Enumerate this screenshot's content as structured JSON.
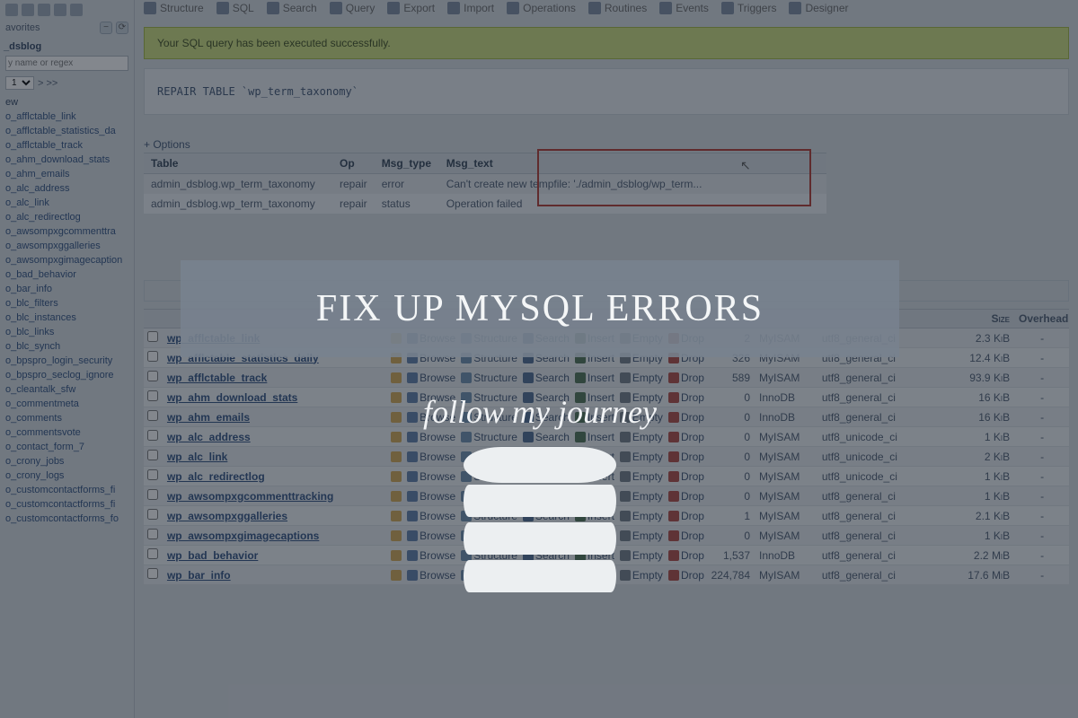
{
  "top_tabs": [
    "Structure",
    "SQL",
    "Search",
    "Query",
    "Export",
    "Import",
    "Operations",
    "Routines",
    "Events",
    "Triggers",
    "Designer"
  ],
  "sidebar": {
    "favorites_label": "avorites",
    "db_label": "_dsblog",
    "filter_placeholder": "y name or regex",
    "pager_value": "1",
    "pager_nav": "> >>",
    "new_label": "ew",
    "tables": [
      "o_afflctable_link",
      "o_afflctable_statistics_da",
      "o_afflctable_track",
      "o_ahm_download_stats",
      "o_ahm_emails",
      "o_alc_address",
      "o_alc_link",
      "o_alc_redirectlog",
      "o_awsompxgcommenttra",
      "o_awsompxggalleries",
      "o_awsompxgimagecaption",
      "o_bad_behavior",
      "o_bar_info",
      "o_blc_filters",
      "o_blc_instances",
      "o_blc_links",
      "o_blc_synch",
      "o_bpspro_login_security",
      "o_bpspro_seclog_ignore",
      "o_cleantalk_sfw",
      "o_commentmeta",
      "o_comments",
      "o_commentsvote",
      "o_contact_form_7",
      "o_crony_jobs",
      "o_crony_logs",
      "o_customcontactforms_fi",
      "o_customcontactforms_fi",
      "o_customcontactforms_fo"
    ]
  },
  "success_msg": "Your SQL query has been executed successfully.",
  "query_text": "REPAIR TABLE `wp_term_taxonomy`",
  "options_label": "+ Options",
  "result": {
    "headers": [
      "Table",
      "Op",
      "Msg_type",
      "Msg_text"
    ],
    "rows": [
      [
        "admin_dsblog.wp_term_taxonomy",
        "repair",
        "error",
        "Can't create new tempfile: './admin_dsblog/wp_term..."
      ],
      [
        "admin_dsblog.wp_term_taxonomy",
        "repair",
        "status",
        "Operation failed"
      ]
    ]
  },
  "list_headers": {
    "size": "Size",
    "overhead": "Overhead"
  },
  "actions": {
    "browse": "Browse",
    "structure": "Structure",
    "search": "Search",
    "insert": "Insert",
    "empty": "Empty",
    "drop": "Drop"
  },
  "list_rows": [
    {
      "name": "wp_afflctable_link",
      "rows": "2",
      "engine": "MyISAM",
      "coll": "utf8_general_ci",
      "size": "2.3 KiB",
      "over": "-"
    },
    {
      "name": "wp_afflctable_statistics_daily",
      "rows": "326",
      "engine": "MyISAM",
      "coll": "utf8_general_ci",
      "size": "12.4 KiB",
      "over": "-"
    },
    {
      "name": "wp_afflctable_track",
      "rows": "589",
      "engine": "MyISAM",
      "coll": "utf8_general_ci",
      "size": "93.9 KiB",
      "over": "-"
    },
    {
      "name": "wp_ahm_download_stats",
      "rows": "0",
      "engine": "InnoDB",
      "coll": "utf8_general_ci",
      "size": "16 KiB",
      "over": "-"
    },
    {
      "name": "wp_ahm_emails",
      "rows": "0",
      "engine": "InnoDB",
      "coll": "utf8_general_ci",
      "size": "16 KiB",
      "over": "-"
    },
    {
      "name": "wp_alc_address",
      "rows": "0",
      "engine": "MyISAM",
      "coll": "utf8_unicode_ci",
      "size": "1 KiB",
      "over": "-"
    },
    {
      "name": "wp_alc_link",
      "rows": "0",
      "engine": "MyISAM",
      "coll": "utf8_unicode_ci",
      "size": "2 KiB",
      "over": "-"
    },
    {
      "name": "wp_alc_redirectlog",
      "rows": "0",
      "engine": "MyISAM",
      "coll": "utf8_unicode_ci",
      "size": "1 KiB",
      "over": "-"
    },
    {
      "name": "wp_awsompxgcommenttracking",
      "rows": "0",
      "engine": "MyISAM",
      "coll": "utf8_general_ci",
      "size": "1 KiB",
      "over": "-"
    },
    {
      "name": "wp_awsompxggalleries",
      "rows": "1",
      "engine": "MyISAM",
      "coll": "utf8_general_ci",
      "size": "2.1 KiB",
      "over": "-"
    },
    {
      "name": "wp_awsompxgimagecaptions",
      "rows": "0",
      "engine": "MyISAM",
      "coll": "utf8_general_ci",
      "size": "1 KiB",
      "over": "-"
    },
    {
      "name": "wp_bad_behavior",
      "rows": "1,537",
      "engine": "InnoDB",
      "coll": "utf8_general_ci",
      "size": "2.2 MiB",
      "over": "-"
    },
    {
      "name": "wp_bar_info",
      "rows": "224,784",
      "engine": "MyISAM",
      "coll": "utf8_general_ci",
      "size": "17.6 MiB",
      "over": "-"
    }
  ],
  "promo": {
    "title": "FIX UP MYSQL ERRORS",
    "subtitle": "follow my journey"
  }
}
